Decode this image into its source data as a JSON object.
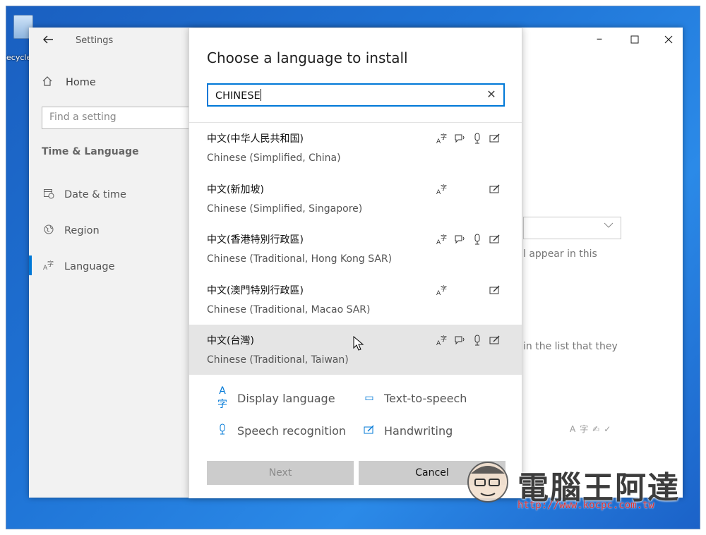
{
  "desktop": {
    "recycle_label": "ecycle"
  },
  "settings": {
    "title": "Settings",
    "home_label": "Home",
    "find_placeholder": "Find a setting",
    "section_heading": "Time & Language",
    "nav": [
      {
        "label": "Date & time",
        "icon": "calendar-clock-icon"
      },
      {
        "label": "Region",
        "icon": "globe-icon"
      },
      {
        "label": "Language",
        "icon": "language-icon",
        "selected": true
      }
    ],
    "background_text": [
      "l appear in this",
      "in the list that they"
    ]
  },
  "dialog": {
    "title": "Choose a language to install",
    "search_value": "CHINESE",
    "languages": [
      {
        "native": "中文(中华人民共和国)",
        "english": "Chinese (Simplified, China)",
        "features": [
          "display",
          "tts",
          "speech",
          "handwriting"
        ]
      },
      {
        "native": "中文(新加坡)",
        "english": "Chinese (Simplified, Singapore)",
        "features": [
          "display",
          "handwriting"
        ]
      },
      {
        "native": "中文(香港特別行政區)",
        "english": "Chinese (Traditional, Hong Kong SAR)",
        "features": [
          "display",
          "tts",
          "speech",
          "handwriting"
        ]
      },
      {
        "native": "中文(澳門特別行政區)",
        "english": "Chinese (Traditional, Macao SAR)",
        "features": [
          "display",
          "handwriting"
        ]
      },
      {
        "native": "中文(台灣)",
        "english": "Chinese (Traditional, Taiwan)",
        "features": [
          "display",
          "tts",
          "speech",
          "handwriting"
        ],
        "selected": true
      }
    ],
    "legend": {
      "display": "Display language",
      "tts": "Text-to-speech",
      "speech": "Speech recognition",
      "handwriting": "Handwriting"
    },
    "buttons": {
      "next": "Next",
      "cancel": "Cancel"
    }
  },
  "watermark": {
    "text": "電腦王阿達",
    "url": "http://www.kocpc.com.tw"
  },
  "colors": {
    "accent": "#0078d7",
    "selected_row": "#e5e5e5",
    "sidebar": "#f2f2f2"
  }
}
